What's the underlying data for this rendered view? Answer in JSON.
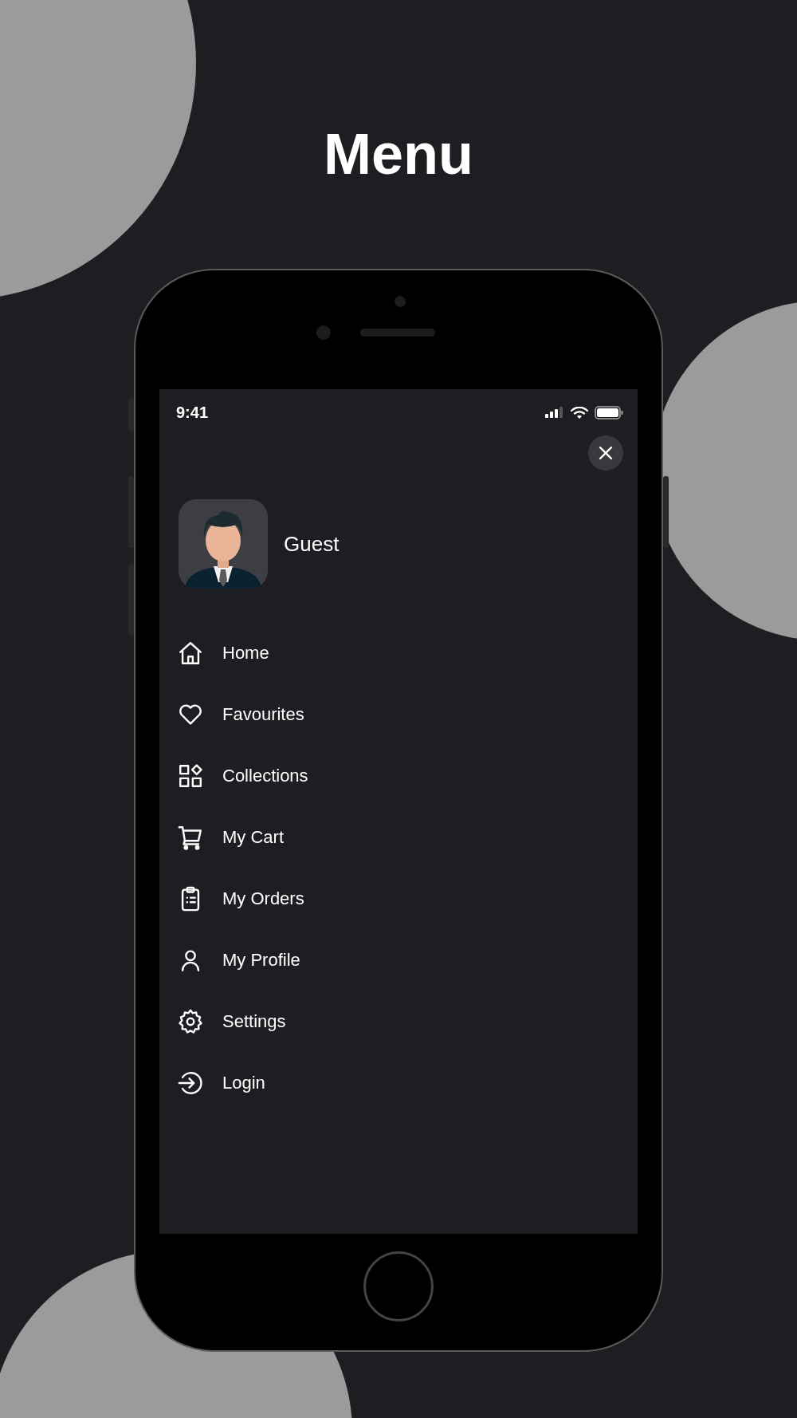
{
  "title": "Menu",
  "status_bar": {
    "time": "9:41"
  },
  "profile": {
    "name": "Guest"
  },
  "menu": [
    {
      "label": "Home",
      "kind": "home"
    },
    {
      "label": "Favourites",
      "kind": "heart"
    },
    {
      "label": "Collections",
      "kind": "grid"
    },
    {
      "label": "My Cart",
      "kind": "cart"
    },
    {
      "label": "My Orders",
      "kind": "clipboard"
    },
    {
      "label": "My Profile",
      "kind": "person"
    },
    {
      "label": "Settings",
      "kind": "gear"
    },
    {
      "label": "Login",
      "kind": "login"
    }
  ]
}
